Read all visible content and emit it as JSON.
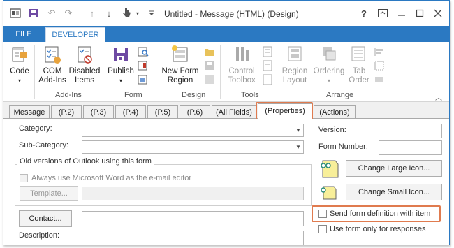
{
  "title_bar": {
    "title": "Untitled - Message (HTML)  (Design)",
    "quick_access": [
      "app-icon",
      "save-icon",
      "undo-icon",
      "redo-icon",
      "up-icon",
      "down-icon",
      "touch-mode-icon",
      "customize-icon"
    ],
    "window_buttons": [
      "?",
      "ribbon-display-icon",
      "minimize-icon",
      "restore-icon",
      "close-icon"
    ],
    "help_label": "?"
  },
  "ribbon_tabs": {
    "file": "FILE",
    "developer": "DEVELOPER"
  },
  "ribbon": {
    "code": "Code",
    "com_addins_1": "COM",
    "com_addins_2": "Add-Ins",
    "disabled_items_1": "Disabled",
    "disabled_items_2": "Items",
    "publish": "Publish",
    "new_form_region_1": "New Form",
    "new_form_region_2": "Region",
    "control_toolbox_1": "Control",
    "control_toolbox_2": "Toolbox",
    "region_layout_1": "Region",
    "region_layout_2": "Layout",
    "ordering": "Ordering",
    "tab_order_1": "Tab",
    "tab_order_2": "Order",
    "groups": {
      "addins": "Add-Ins",
      "form": "Form",
      "design": "Design",
      "tools": "Tools",
      "arrange": "Arrange"
    }
  },
  "form_tabs": [
    "Message",
    "(P.2)",
    "(P.3)",
    "(P.4)",
    "(P.5)",
    "(P.6)",
    "(All Fields)",
    "(Properties)",
    "(Actions)"
  ],
  "form_tabs_active": "(Properties)",
  "properties": {
    "category_label": "Category:",
    "subcategory_label": "Sub-Category:",
    "old_versions_title": "Old versions of Outlook using this form",
    "always_word_label": "Always use Microsoft Word as the e-mail editor",
    "template_button": "Template...",
    "contact_button": "Contact...",
    "description_label": "Description:",
    "version_label": "Version:",
    "form_number_label": "Form Number:",
    "change_large_icon": "Change Large Icon...",
    "change_small_icon": "Change Small Icon...",
    "send_form_definition": "Send form definition with item",
    "use_form_only": "Use form only for responses"
  },
  "colors": {
    "accent": "#2b79c2",
    "highlight": "#e07b4f"
  }
}
